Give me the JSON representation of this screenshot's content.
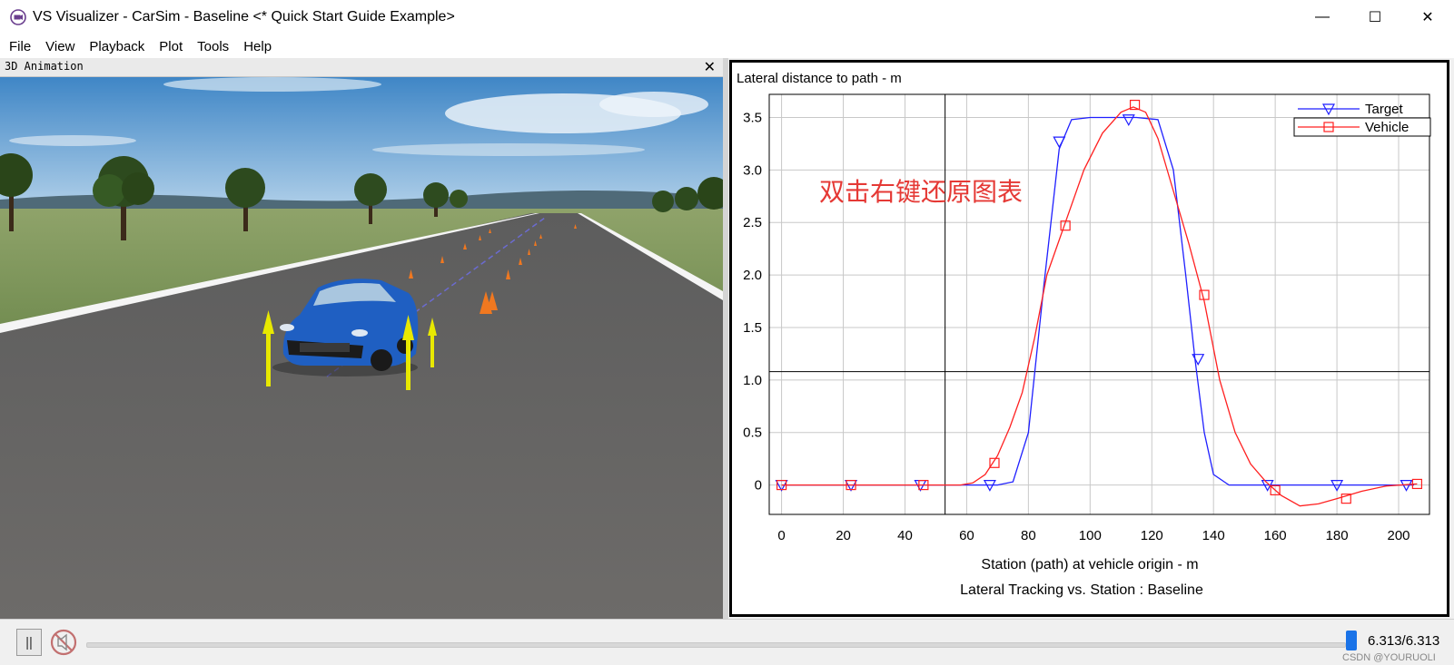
{
  "window": {
    "title": "VS Visualizer - CarSim - Baseline <* Quick Start Guide Example>",
    "controls": {
      "minimize": "—",
      "maximize": "☐",
      "close": "✕"
    }
  },
  "menu": [
    "File",
    "View",
    "Playback",
    "Plot",
    "Tools",
    "Help"
  ],
  "animation_panel": {
    "title": "3D Animation",
    "close": "✕"
  },
  "plot_panel": {
    "annotation": "双击右键还原图表",
    "annotation_color": "#e53935"
  },
  "chart_data": {
    "type": "line",
    "title": "Lateral distance to path - m",
    "xlabel": "Station (path) at vehicle origin - m",
    "caption": "Lateral Tracking vs. Station : Baseline",
    "xlim": [
      -4,
      210
    ],
    "ylim": [
      -0.28,
      3.72
    ],
    "x_ticks": [
      0,
      20,
      40,
      60,
      80,
      100,
      120,
      140,
      160,
      180,
      200
    ],
    "y_ticks": [
      0,
      0.5,
      1.0,
      1.5,
      2.0,
      2.5,
      3.0,
      3.5
    ],
    "y_tick_labels": [
      "0",
      "0.5",
      "1.0",
      "1.5",
      "2.0",
      "2.5",
      "3.0",
      "3.5"
    ],
    "grid": true,
    "legend_position": "top-right",
    "crosshair": {
      "x": 53,
      "y": 1.08
    },
    "series": [
      {
        "name": "Target",
        "color": "#1f1fff",
        "marker": "triangle-down",
        "points": [
          [
            0,
            0
          ],
          [
            60,
            0
          ],
          [
            70,
            0
          ],
          [
            75,
            0.03
          ],
          [
            80,
            0.5
          ],
          [
            85,
            1.9
          ],
          [
            90,
            3.2
          ],
          [
            94,
            3.48
          ],
          [
            100,
            3.5
          ],
          [
            115,
            3.5
          ],
          [
            122,
            3.48
          ],
          [
            127,
            3.0
          ],
          [
            131,
            2.0
          ],
          [
            134,
            1.2
          ],
          [
            137,
            0.5
          ],
          [
            140,
            0.1
          ],
          [
            145,
            0
          ],
          [
            205,
            0
          ]
        ],
        "marker_points": [
          [
            0,
            0
          ],
          [
            22.5,
            0
          ],
          [
            45,
            0
          ],
          [
            67.5,
            0
          ],
          [
            90,
            3.27
          ],
          [
            112.5,
            3.48
          ],
          [
            135,
            1.2
          ],
          [
            157.5,
            0
          ],
          [
            180,
            0
          ],
          [
            202.5,
            0
          ]
        ]
      },
      {
        "name": "Vehicle",
        "color": "#ff2020",
        "marker": "square",
        "points": [
          [
            0,
            0
          ],
          [
            58,
            0
          ],
          [
            62,
            0.02
          ],
          [
            66,
            0.1
          ],
          [
            70,
            0.28
          ],
          [
            74,
            0.55
          ],
          [
            78,
            0.88
          ],
          [
            82,
            1.4
          ],
          [
            86,
            2.0
          ],
          [
            92,
            2.5
          ],
          [
            98,
            3.0
          ],
          [
            104,
            3.35
          ],
          [
            110,
            3.55
          ],
          [
            114,
            3.6
          ],
          [
            118,
            3.55
          ],
          [
            122,
            3.3
          ],
          [
            127,
            2.8
          ],
          [
            132,
            2.3
          ],
          [
            137,
            1.75
          ],
          [
            142,
            1.0
          ],
          [
            147,
            0.5
          ],
          [
            152,
            0.2
          ],
          [
            157,
            0.03
          ],
          [
            162,
            -0.1
          ],
          [
            168,
            -0.2
          ],
          [
            174,
            -0.18
          ],
          [
            180,
            -0.13
          ],
          [
            188,
            -0.06
          ],
          [
            196,
            -0.01
          ],
          [
            206,
            0.01
          ]
        ],
        "marker_points": [
          [
            0,
            0
          ],
          [
            22.5,
            0
          ],
          [
            46,
            0
          ],
          [
            69,
            0.21
          ],
          [
            92,
            2.47
          ],
          [
            114.5,
            3.62
          ],
          [
            137,
            1.81
          ],
          [
            160,
            -0.05
          ],
          [
            183,
            -0.13
          ],
          [
            206,
            0.01
          ]
        ]
      }
    ]
  },
  "playback": {
    "pause_label": "||",
    "time_readout": "6.313/6.313",
    "progress": 1.0,
    "watermark": "CSDN @YOURUOLI"
  }
}
